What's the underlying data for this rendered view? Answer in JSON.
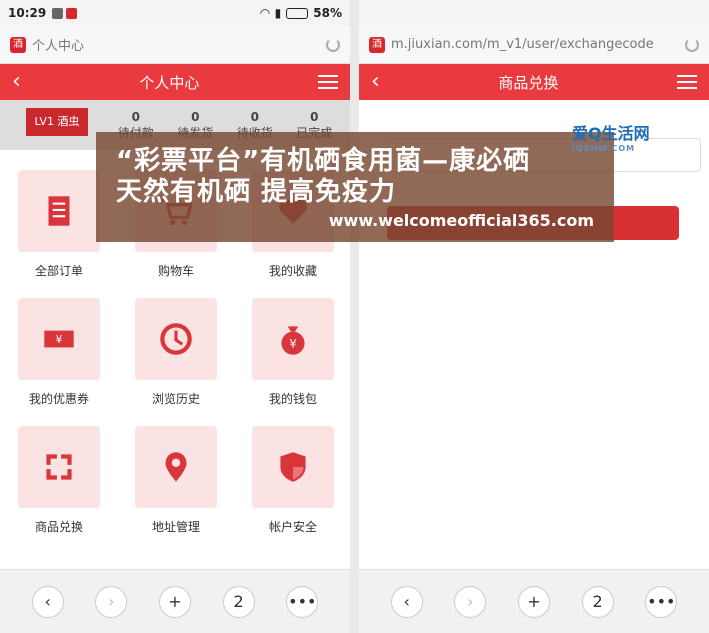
{
  "left": {
    "status": {
      "time": "10:29",
      "battery": "58%"
    },
    "url": "个人中心",
    "title": "个人中心",
    "level_badge": "LV1 酒虫",
    "orders": [
      {
        "count": "0",
        "label": "待付款"
      },
      {
        "count": "0",
        "label": "待发货"
      },
      {
        "count": "0",
        "label": "待收货"
      },
      {
        "count": "0",
        "label": "已完成"
      }
    ],
    "grid": [
      {
        "label": "全部订单",
        "icon": "document-icon"
      },
      {
        "label": "购物车",
        "icon": "cart-icon"
      },
      {
        "label": "我的收藏",
        "icon": "heart-icon"
      },
      {
        "label": "我的优惠券",
        "icon": "coupon-icon"
      },
      {
        "label": "浏览历史",
        "icon": "clock-icon"
      },
      {
        "label": "我的钱包",
        "icon": "money-bag-icon"
      },
      {
        "label": "商品兑换",
        "icon": "exchange-icon"
      },
      {
        "label": "地址管理",
        "icon": "location-pin-icon"
      },
      {
        "label": "帐户安全",
        "icon": "shield-icon"
      }
    ],
    "bottom": {
      "tabs_count": "2"
    }
  },
  "right": {
    "url": "m.jiuxian.com/m_v1/user/exchangecode",
    "title": "商品兑换",
    "bottom": {
      "tabs_count": "2"
    }
  },
  "overlay": {
    "line1": "“彩票平台”有机硒食用菌—康必硒",
    "line2": "天然有机硒 提高免疫力",
    "url": "www.welcomeofficial365.com",
    "logo": "爱Q生活网",
    "logo_sub": "IQSHW.COM"
  },
  "colors": {
    "brand_red": "#e83a3f",
    "icon_bg": "#fbe3e3"
  }
}
